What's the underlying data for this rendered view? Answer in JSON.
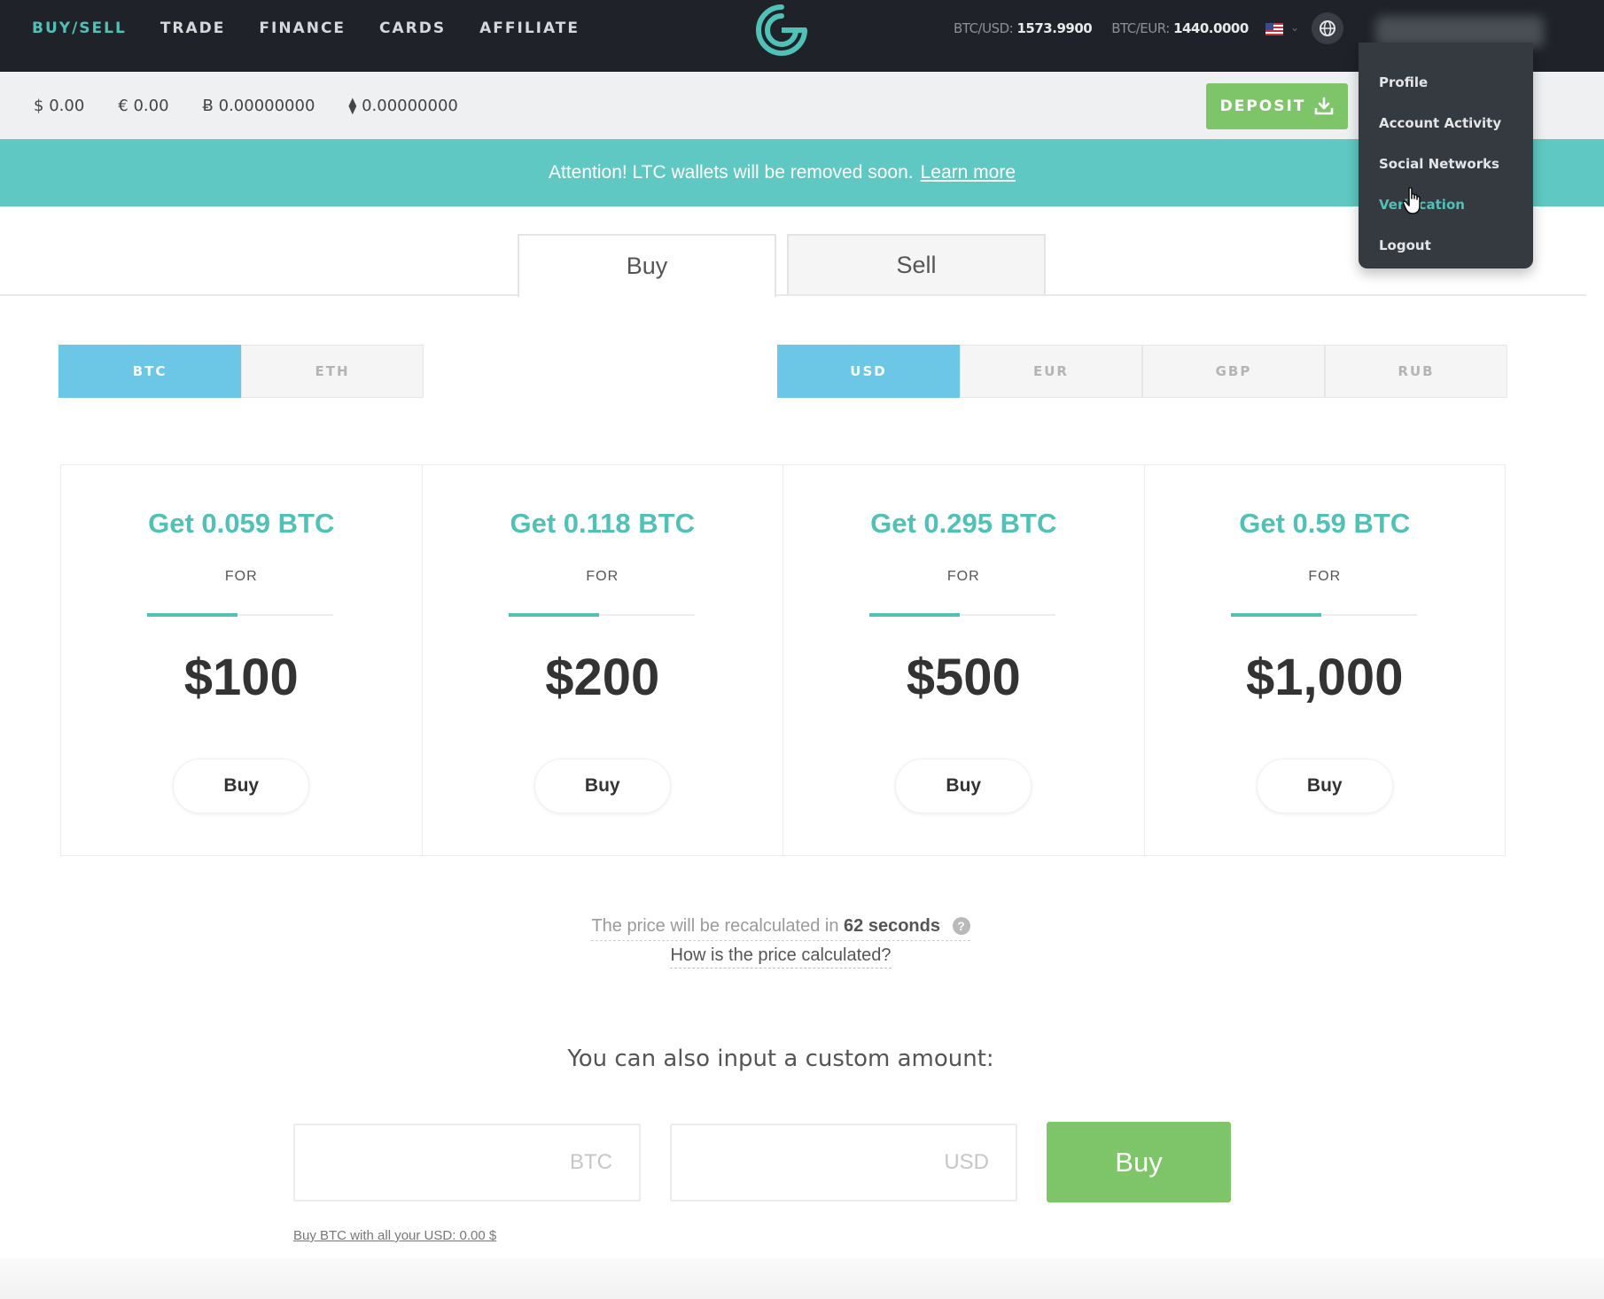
{
  "nav": {
    "links": [
      {
        "label": "BUY/SELL",
        "active": true
      },
      {
        "label": "TRADE",
        "active": false
      },
      {
        "label": "FINANCE",
        "active": false
      },
      {
        "label": "CARDS",
        "active": false
      },
      {
        "label": "AFFILIATE",
        "active": false
      }
    ],
    "rates": [
      {
        "label": "BTC/USD:",
        "value": "1573.9900"
      },
      {
        "label": "BTC/EUR:",
        "value": "1440.0000"
      }
    ],
    "icons": {
      "logo": "cex-logo-icon",
      "flag": "us-flag-icon",
      "globe": "globe-icon"
    }
  },
  "balances": [
    {
      "symbol": "$",
      "amount": "0.00"
    },
    {
      "symbol": "€",
      "amount": "0.00"
    },
    {
      "symbol": "Ƀ",
      "amount": "0.00000000"
    },
    {
      "symbol": "⧫",
      "amount": "0.00000000"
    }
  ],
  "deposit_label": "DEPOSIT",
  "banner": {
    "text": "Attention! LTC wallets will be removed soon.",
    "link": "Learn more"
  },
  "tabs": {
    "buy": "Buy",
    "sell": "Sell"
  },
  "crypto_options": [
    "BTC",
    "ETH"
  ],
  "fiat_options": [
    "USD",
    "EUR",
    "GBP",
    "RUB"
  ],
  "packages": [
    {
      "title": "Get 0.059 BTC",
      "for": "FOR",
      "price": "$100",
      "button": "Buy"
    },
    {
      "title": "Get 0.118 BTC",
      "for": "FOR",
      "price": "$200",
      "button": "Buy"
    },
    {
      "title": "Get 0.295 BTC",
      "for": "FOR",
      "price": "$500",
      "button": "Buy"
    },
    {
      "title": "Get 0.59 BTC",
      "for": "FOR",
      "price": "$1,000",
      "button": "Buy"
    }
  ],
  "recalc": {
    "prefix": "The price will be recalculated in",
    "seconds": "62 seconds",
    "help": "?",
    "link": "How is the price calculated?"
  },
  "custom": {
    "title": "You can also input a custom amount:",
    "btc_placeholder": "BTC",
    "usd_placeholder": "USD",
    "buy_label": "Buy",
    "buy_all": "Buy BTC with all your USD: 0.00 $"
  },
  "dropdown": {
    "items": [
      "Profile",
      "Account Activity",
      "Social Networks",
      "Verification",
      "Logout"
    ]
  },
  "colors": {
    "accent": "#4fc1b6",
    "green": "#7ec56a",
    "blue": "#6cc6e6",
    "nav_bg": "#1f2228",
    "banner": "#5fc8c2"
  }
}
